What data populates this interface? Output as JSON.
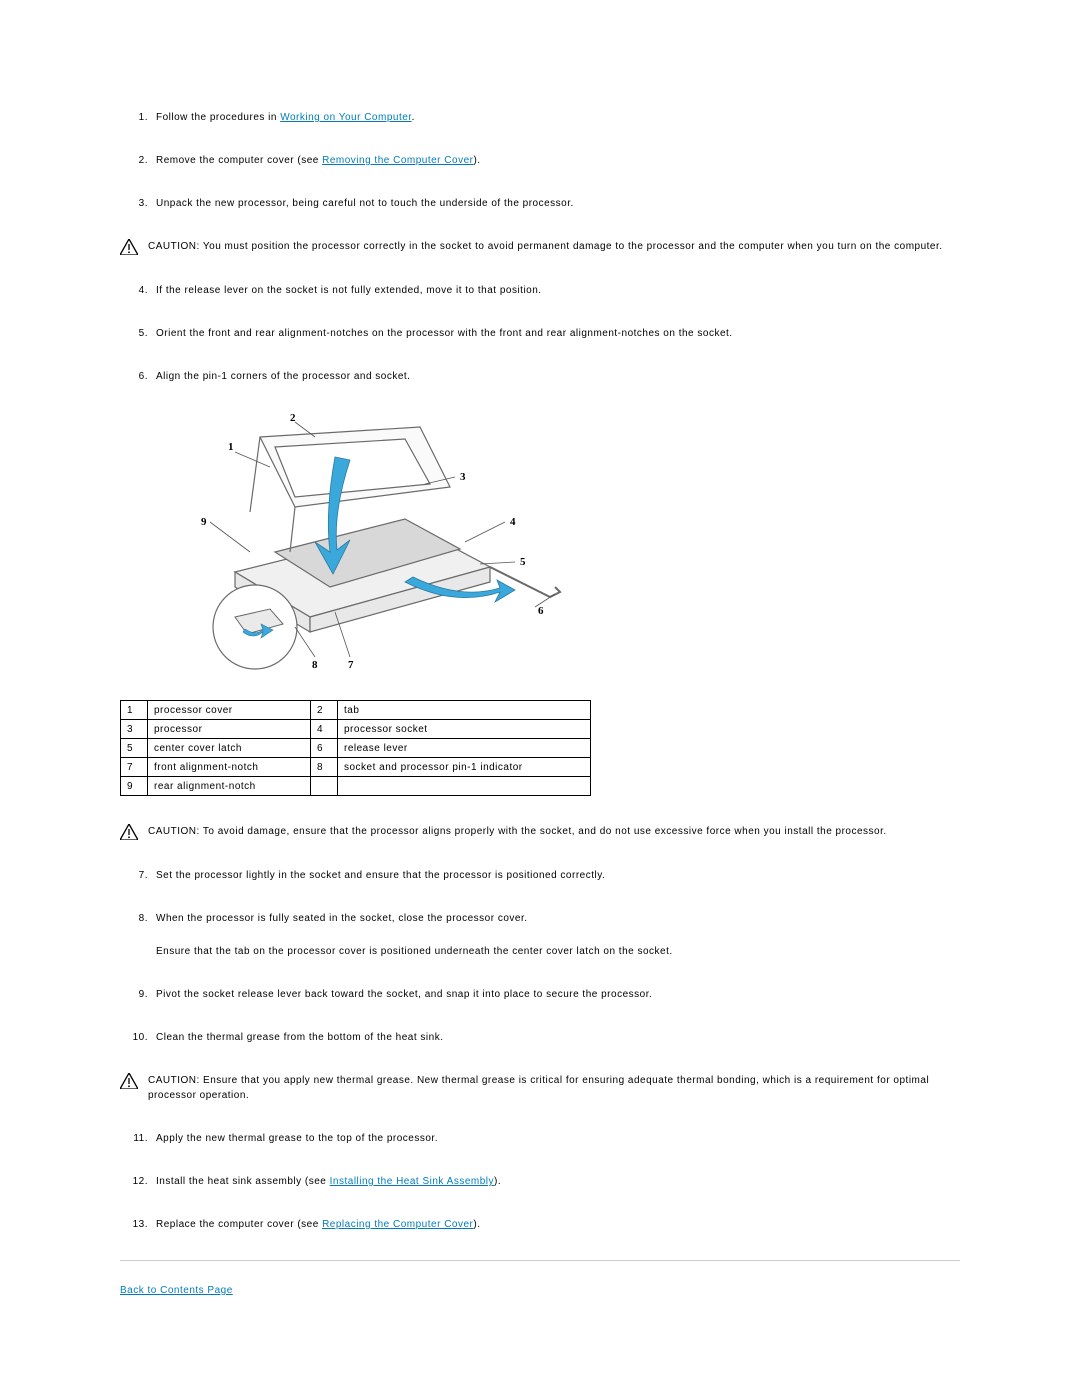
{
  "steps_a": [
    {
      "n": "1.",
      "pre": "Follow the procedures in ",
      "link": "Working on Your Computer",
      "post": "."
    },
    {
      "n": "2.",
      "pre": "Remove the computer cover (see ",
      "link": "Removing the Computer Cover",
      "post": ")."
    },
    {
      "n": "3.",
      "pre": "Unpack the new processor, being careful not to touch the underside of the processor.",
      "link": "",
      "post": ""
    }
  ],
  "caution1": {
    "label": "CAUTION:",
    "text": " You must position the processor correctly in the socket to avoid permanent damage to the processor and the computer when you turn on the computer."
  },
  "steps_b": [
    {
      "n": "4.",
      "pre": "If the release lever on the socket is not fully extended, move it to that position.",
      "link": "",
      "post": ""
    },
    {
      "n": "5.",
      "pre": "Orient the front and rear alignment-notches on the processor with the front and rear alignment-notches on the socket.",
      "link": "",
      "post": ""
    },
    {
      "n": "6.",
      "pre": "Align the pin-1 corners of the processor and socket.",
      "link": "",
      "post": ""
    }
  ],
  "diagram_labels": {
    "l1": "1",
    "l2": "2",
    "l3": "3",
    "l4": "4",
    "l5": "5",
    "l6": "6",
    "l7": "7",
    "l8": "8",
    "l9": "9"
  },
  "table": [
    {
      "a": "1",
      "al": "processor cover",
      "b": "2",
      "bl": "tab"
    },
    {
      "a": "3",
      "al": "processor",
      "b": "4",
      "bl": "processor socket"
    },
    {
      "a": "5",
      "al": "center cover latch",
      "b": "6",
      "bl": "release lever"
    },
    {
      "a": "7",
      "al": "front alignment-notch",
      "b": "8",
      "bl": "socket and processor pin-1 indicator"
    },
    {
      "a": "9",
      "al": "rear alignment-notch",
      "b": "",
      "bl": ""
    }
  ],
  "caution2": {
    "label": "CAUTION:",
    "text": " To avoid damage, ensure that the processor aligns properly with the socket, and do not use excessive force when you install the processor."
  },
  "steps_c": [
    {
      "n": "7.",
      "pre": "Set the processor lightly in the socket and ensure that the processor is positioned correctly.",
      "link": "",
      "post": ""
    },
    {
      "n": "8.",
      "pre": "When the processor is fully seated in the socket, close the processor cover.",
      "link": "",
      "post": "",
      "extra": "Ensure that the tab on the processor cover is positioned underneath the center cover latch on the socket."
    },
    {
      "n": "9.",
      "pre": "Pivot the socket release lever back toward the socket, and snap it into place to secure the processor.",
      "link": "",
      "post": ""
    },
    {
      "n": "10.",
      "pre": "Clean the thermal grease from the bottom of the heat sink.",
      "link": "",
      "post": ""
    }
  ],
  "caution3": {
    "label": "CAUTION:",
    "text": " Ensure that you apply new thermal grease. New thermal grease is critical for ensuring adequate thermal bonding, which is a requirement for optimal processor operation."
  },
  "steps_d": [
    {
      "n": "11.",
      "pre": "Apply the new thermal grease to the top of the processor.",
      "link": "",
      "post": ""
    },
    {
      "n": "12.",
      "pre": "Install the heat sink assembly (see ",
      "link": "Installing the Heat Sink Assembly",
      "post": ")."
    },
    {
      "n": "13.",
      "pre": "Replace the computer cover (see ",
      "link": "Replacing the Computer Cover",
      "post": ")."
    }
  ],
  "back_link": "Back to Contents Page"
}
